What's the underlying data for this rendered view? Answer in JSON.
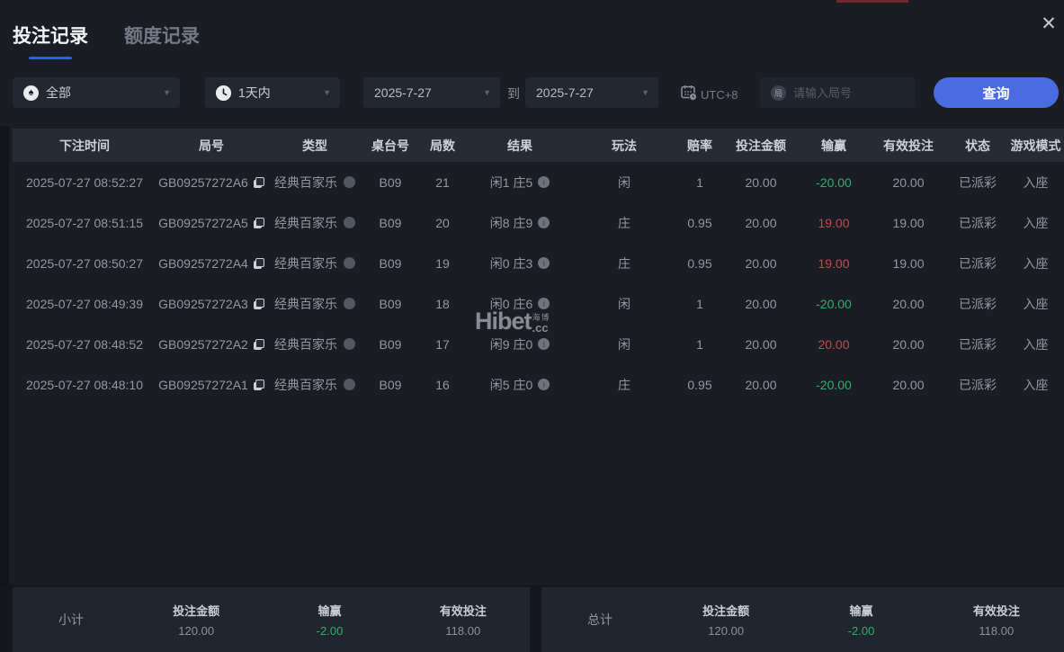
{
  "window": {
    "close_icon": "✕"
  },
  "tabs": [
    {
      "label": "投注记录",
      "active": true
    },
    {
      "label": "额度记录",
      "active": false
    }
  ],
  "filters": {
    "game_type": {
      "value": "全部",
      "icon": "spade-icon",
      "icon_glyph": "♠"
    },
    "time_range": {
      "value": "1天内",
      "icon": "clock-icon"
    },
    "date_from": "2025-7-27",
    "to_label": "到",
    "date_to": "2025-7-27",
    "timezone": "UTC+8",
    "round_placeholder": "请输入局号",
    "round_icon_glyph": "局",
    "search_button": "查询"
  },
  "table": {
    "headers": [
      "下注时间",
      "局号",
      "类型",
      "桌台号",
      "局数",
      "结果",
      "玩法",
      "赔率",
      "投注金额",
      "输赢",
      "有效投注",
      "状态",
      "游戏模式"
    ],
    "rows": [
      {
        "time": "2025-07-27 08:52:27",
        "round_id": "GB09257272A6",
        "type": "经典百家乐",
        "table_no": "B09",
        "game_no": "21",
        "result": "闲1 庄5",
        "play": "闲",
        "odds": "1",
        "bet_amount": "20.00",
        "win_loss": "-20.00",
        "valid_bet": "20.00",
        "status": "已派彩",
        "mode": "入座"
      },
      {
        "time": "2025-07-27 08:51:15",
        "round_id": "GB09257272A5",
        "type": "经典百家乐",
        "table_no": "B09",
        "game_no": "20",
        "result": "闲8 庄9",
        "play": "庄",
        "odds": "0.95",
        "bet_amount": "20.00",
        "win_loss": "19.00",
        "valid_bet": "19.00",
        "status": "已派彩",
        "mode": "入座"
      },
      {
        "time": "2025-07-27 08:50:27",
        "round_id": "GB09257272A4",
        "type": "经典百家乐",
        "table_no": "B09",
        "game_no": "19",
        "result": "闲0 庄3",
        "play": "庄",
        "odds": "0.95",
        "bet_amount": "20.00",
        "win_loss": "19.00",
        "valid_bet": "19.00",
        "status": "已派彩",
        "mode": "入座"
      },
      {
        "time": "2025-07-27 08:49:39",
        "round_id": "GB09257272A3",
        "type": "经典百家乐",
        "table_no": "B09",
        "game_no": "18",
        "result": "闲0 庄6",
        "play": "闲",
        "odds": "1",
        "bet_amount": "20.00",
        "win_loss": "-20.00",
        "valid_bet": "20.00",
        "status": "已派彩",
        "mode": "入座"
      },
      {
        "time": "2025-07-27 08:48:52",
        "round_id": "GB09257272A2",
        "type": "经典百家乐",
        "table_no": "B09",
        "game_no": "17",
        "result": "闲9 庄0",
        "play": "闲",
        "odds": "1",
        "bet_amount": "20.00",
        "win_loss": "20.00",
        "valid_bet": "20.00",
        "status": "已派彩",
        "mode": "入座"
      },
      {
        "time": "2025-07-27 08:48:10",
        "round_id": "GB09257272A1",
        "type": "经典百家乐",
        "table_no": "B09",
        "game_no": "16",
        "result": "闲5 庄0",
        "play": "庄",
        "odds": "0.95",
        "bet_amount": "20.00",
        "win_loss": "-20.00",
        "valid_bet": "20.00",
        "status": "已派彩",
        "mode": "入座"
      }
    ]
  },
  "watermark": {
    "brand": "Hibet",
    "cn": "海博",
    "suffix": ".cc"
  },
  "summary": {
    "panels": [
      {
        "label": "小计",
        "items": [
          {
            "name": "投注金额",
            "value": "120.00"
          },
          {
            "name": "输赢",
            "value": "-2.00"
          },
          {
            "name": "有效投注",
            "value": "118.00"
          }
        ]
      },
      {
        "label": "总计",
        "items": [
          {
            "name": "投注金额",
            "value": "120.00"
          },
          {
            "name": "输赢",
            "value": "-2.00"
          },
          {
            "name": "有效投注",
            "value": "118.00"
          }
        ]
      }
    ]
  },
  "colors": {
    "accent_blue": "#4a6ce0",
    "win_red": "#c84848",
    "loss_green": "#2fae6d",
    "tab_underline": "#2d5cf6"
  }
}
